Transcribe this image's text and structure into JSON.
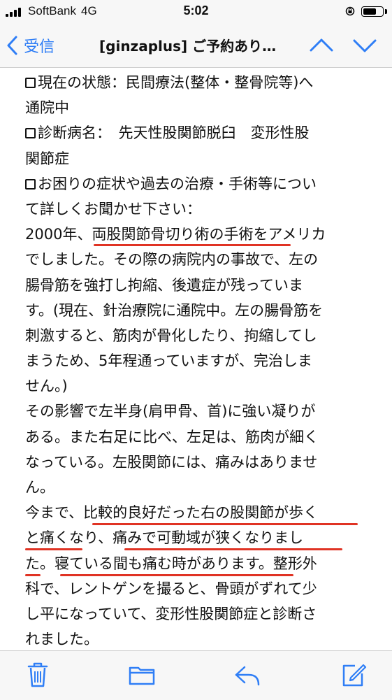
{
  "status_bar": {
    "carrier": "SoftBank",
    "network": "4G",
    "time": "5:02"
  },
  "nav": {
    "back_label": "受信",
    "title": "[ginzaplus] ご予約あり…"
  },
  "body_lines": [
    "現在の状態：民間療法(整体・整骨院等)へ",
    "通院中",
    "診断病名：　先天性股関節脱臼　変形性股",
    "関節症",
    "お困りの症状や過去の治療・手術等につい",
    "て詳しくお聞かせ下さい：",
    "2000年、両股関節骨切り術の手術をアメリカ",
    "でしました。その際の病院内の事故で、左の",
    "腸骨筋を強打し拘縮、後遺症が残っていま",
    "す。(現在、針治療院に通院中。左の腸骨筋を",
    "刺激すると、筋肉が骨化したり、拘縮してし",
    "まうため、5年程通っていますが、完治しま",
    "せん。)",
    "その影響で左半身(肩甲骨、首)に強い凝りが",
    "ある。また右足に比べ、左足は、筋肉が細く",
    "なっている。左股関節には、痛みはありませ",
    "ん。",
    "今まで、比較的良好だった右の股関節が歩く",
    "と痛くなり、痛みで可動域が狭くなりまし",
    "た。寝ている間も痛む時があります。整形外",
    "科で、レントゲンを撮ると、骨頭がずれて少",
    "し平になっていて、変形性股関節症と診断さ",
    "れました。"
  ],
  "colors": {
    "accent": "#2f7ef6",
    "highlight_underline": "#e03324",
    "bars": "#f7f7f7"
  },
  "icons": {
    "toolbar": [
      "trash-icon",
      "folder-icon",
      "reply-icon",
      "compose-icon"
    ],
    "nav": [
      "chevron-left-icon",
      "chevron-up-icon",
      "chevron-down-icon"
    ]
  }
}
